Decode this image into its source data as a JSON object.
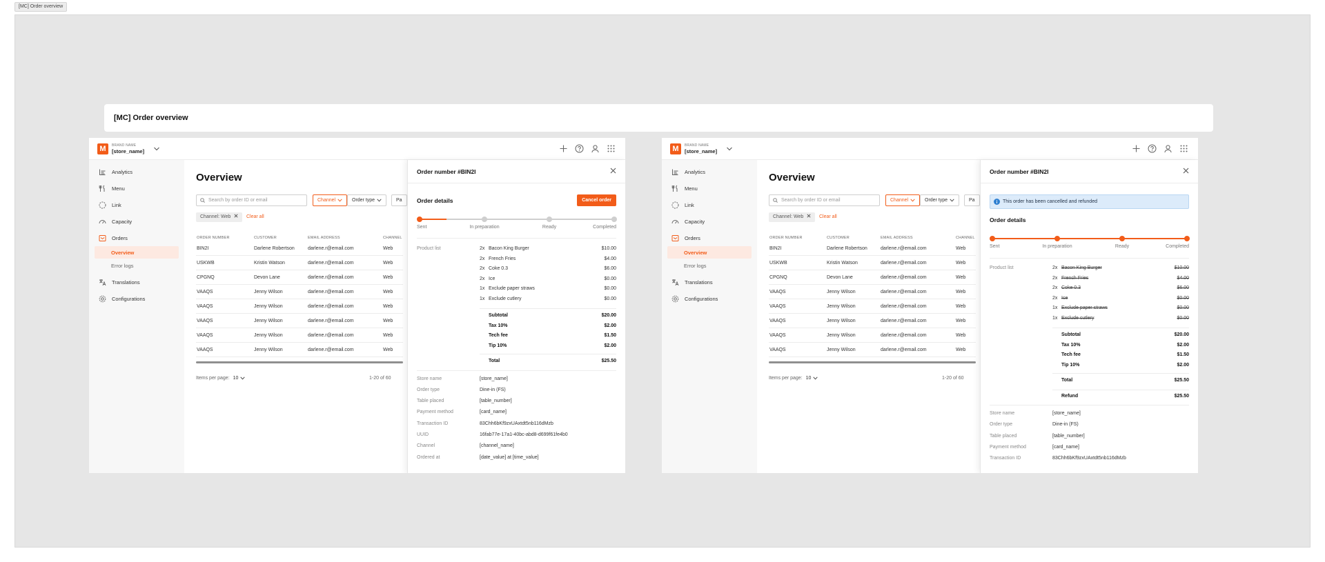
{
  "frame_tag": "[MC] Order overview",
  "page_title": "[MC] Order overview",
  "brand": {
    "label": "BRAND NAME",
    "store": "[store_name]",
    "logo_letter": "M",
    "accent": "#f25c19"
  },
  "topbar_icons": [
    "plus-icon",
    "help-icon",
    "user-icon",
    "apps-grid-icon"
  ],
  "nav": [
    {
      "label": "Analytics",
      "icon": "analytics-icon"
    },
    {
      "label": "Menu",
      "icon": "menu-icon"
    },
    {
      "label": "Link",
      "icon": "link-icon"
    },
    {
      "label": "Capacity",
      "icon": "capacity-icon"
    },
    {
      "label": "Orders",
      "icon": "orders-icon"
    },
    {
      "label": "Overview",
      "active": true
    },
    {
      "label": "Error logs"
    },
    {
      "label": "Translations",
      "icon": "translations-icon"
    },
    {
      "label": "Configurations",
      "icon": "configurations-icon"
    }
  ],
  "overview": {
    "title": "Overview",
    "search_placeholder": "Search by order ID or email",
    "filters": [
      "Channel",
      "Order type",
      "Pa"
    ],
    "active_chip": "Channel: Web",
    "clear_all": "Clear all",
    "columns": [
      "ORDER NUMBER",
      "CUSTOMER",
      "EMAIL ADDRESS",
      "CHANNEL"
    ],
    "rows": [
      [
        "BIN2I",
        "Darlene Robertson",
        "darlene.r@email.com",
        "Web"
      ],
      [
        "USKWB",
        "Kristin Watson",
        "darlene.r@email.com",
        "Web"
      ],
      [
        "CPGNQ",
        "Devon Lane",
        "darlene.r@email.com",
        "Web"
      ],
      [
        "VAAQS",
        "Jenny Wilson",
        "darlene.r@email.com",
        "Web"
      ],
      [
        "VAAQS",
        "Jenny Wilson",
        "darlene.r@email.com",
        "Web"
      ],
      [
        "VAAQS",
        "Jenny Wilson",
        "darlene.r@email.com",
        "Web"
      ],
      [
        "VAAQS",
        "Jenny Wilson",
        "darlene.r@email.com",
        "Web"
      ],
      [
        "VAAQS",
        "Jenny Wilson",
        "darlene.r@email.com",
        "Web"
      ]
    ],
    "items_per_page_label": "Items per page:",
    "items_per_page_value": "10",
    "range_text": "1-20 of 60"
  },
  "panel_active": {
    "title": "Order number #BIN2I",
    "section": "Order details",
    "cancel_label": "Cancel order",
    "steps": [
      "Sent",
      "In preparation",
      "Ready",
      "Completed"
    ],
    "progress": 0.14,
    "product_list_label": "Product list",
    "products": [
      {
        "qty": "2x",
        "name": "Bacon King Burger",
        "price": "$10.00"
      },
      {
        "qty": "2x",
        "name": "French Fries",
        "price": "$4.00"
      },
      {
        "qty": "2x",
        "name": "Coke 0.3",
        "price": "$6.00"
      },
      {
        "qty": "2x",
        "name": "Ice",
        "price": "$0.00"
      },
      {
        "qty": "1x",
        "name": "Exclude paper straws",
        "price": "$0.00"
      },
      {
        "qty": "1x",
        "name": "Exclude cutlery",
        "price": "$0.00"
      }
    ],
    "totals": [
      {
        "label": "Subtotal",
        "value": "$20.00"
      },
      {
        "label": "Tax 10%",
        "value": "$2.00"
      },
      {
        "label": "Tech fee",
        "value": "$1.50"
      },
      {
        "label": "Tip 10%",
        "value": "$2.00"
      }
    ],
    "total": {
      "label": "Total",
      "value": "$25.50"
    },
    "meta": [
      {
        "label": "Store name",
        "value": "[store_name]"
      },
      {
        "label": "Order type",
        "value": "Dine-in (FS)"
      },
      {
        "label": "Table placed",
        "value": "[table_number]"
      },
      {
        "label": "Payment method",
        "value": "[card_name]"
      },
      {
        "label": "Transaction ID",
        "value": "83Chh6bKf9zxUAxtdt5nb116dMzb"
      },
      {
        "label": "UUID",
        "value": "16fab77e-17a1-40bc-abd8-d699f61fe4b0"
      },
      {
        "label": "Channel",
        "value": "[channel_name]"
      },
      {
        "label": "Ordered at",
        "value": "[date_value] at [time_value]"
      }
    ]
  },
  "panel_cancelled": {
    "title": "Order number #BIN2I",
    "alert": "This order has been cancelled and refunded",
    "section": "Order details",
    "steps": [
      "Sent",
      "In preparation",
      "Ready",
      "Completed"
    ],
    "progress": 1.0,
    "product_list_label": "Product list",
    "products": [
      {
        "qty": "2x",
        "name": "Bacon King Burger",
        "price": "$10.00"
      },
      {
        "qty": "2x",
        "name": "French Fries",
        "price": "$4.00"
      },
      {
        "qty": "2x",
        "name": "Coke 0.3",
        "price": "$6.00"
      },
      {
        "qty": "2x",
        "name": "Ice",
        "price": "$0.00"
      },
      {
        "qty": "1x",
        "name": "Exclude paper straws",
        "price": "$0.00"
      },
      {
        "qty": "1x",
        "name": "Exclude cutlery",
        "price": "$0.00"
      }
    ],
    "totals": [
      {
        "label": "Subtotal",
        "value": "$20.00"
      },
      {
        "label": "Tax 10%",
        "value": "$2.00"
      },
      {
        "label": "Tech fee",
        "value": "$1.50"
      },
      {
        "label": "Tip 10%",
        "value": "$2.00"
      }
    ],
    "total": {
      "label": "Total",
      "value": "$25.50"
    },
    "refund": {
      "label": "Refund",
      "value": "$25.50"
    },
    "meta": [
      {
        "label": "Store name",
        "value": "[store_name]"
      },
      {
        "label": "Order type",
        "value": "Dine-in (FS)"
      },
      {
        "label": "Table placed",
        "value": "[table_number]"
      },
      {
        "label": "Payment method",
        "value": "[card_name]"
      },
      {
        "label": "Transaction ID",
        "value": "83Chh6bKf9zxUAxtdt5nb116dMzb"
      }
    ]
  }
}
